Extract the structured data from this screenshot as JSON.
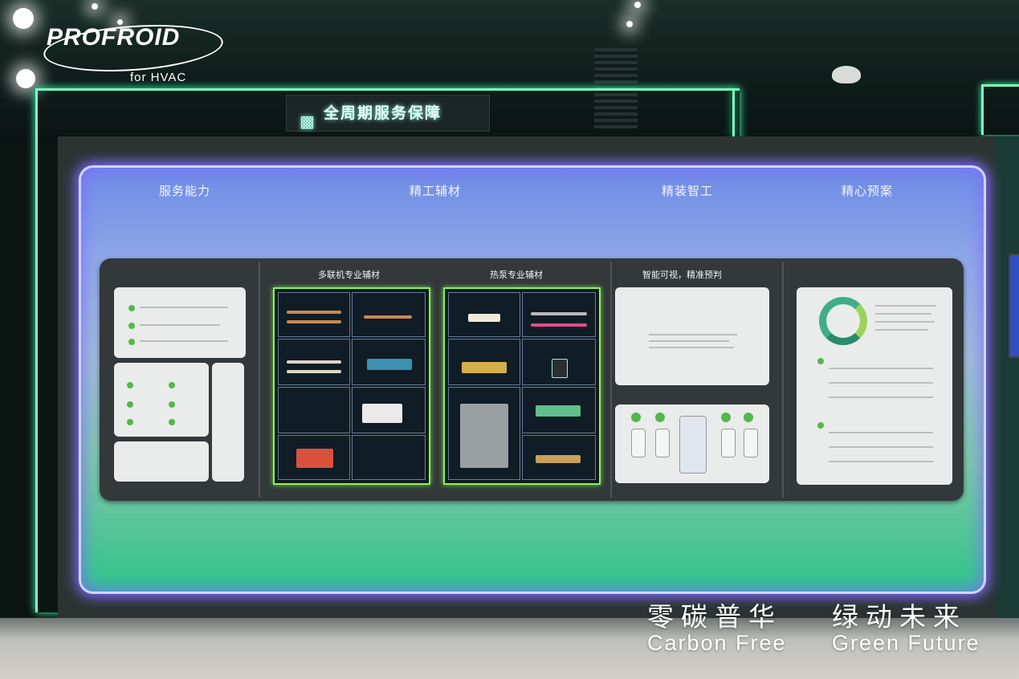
{
  "logo": {
    "name": "PROFROID",
    "sub": "for HVAC"
  },
  "sign": {
    "text": "全周期服务保障",
    "icon": "building-icon"
  },
  "categories": [
    "服务能力",
    "精工辅材",
    "精装智工",
    "精心预案"
  ],
  "subheaders": {
    "vrf": "多联机专业辅材",
    "heat_pump": "热泵专业辅材",
    "smart": "智能可视，精准预判"
  },
  "slogan": {
    "cn_left": "零碳普华",
    "cn_right": "绿动未来",
    "en_left": "Carbon Free",
    "en_right": "Green Future"
  },
  "colors": {
    "neon": "#7dffc8",
    "panel_glow": "#7c6cff",
    "accent_green": "#8ef05c"
  }
}
